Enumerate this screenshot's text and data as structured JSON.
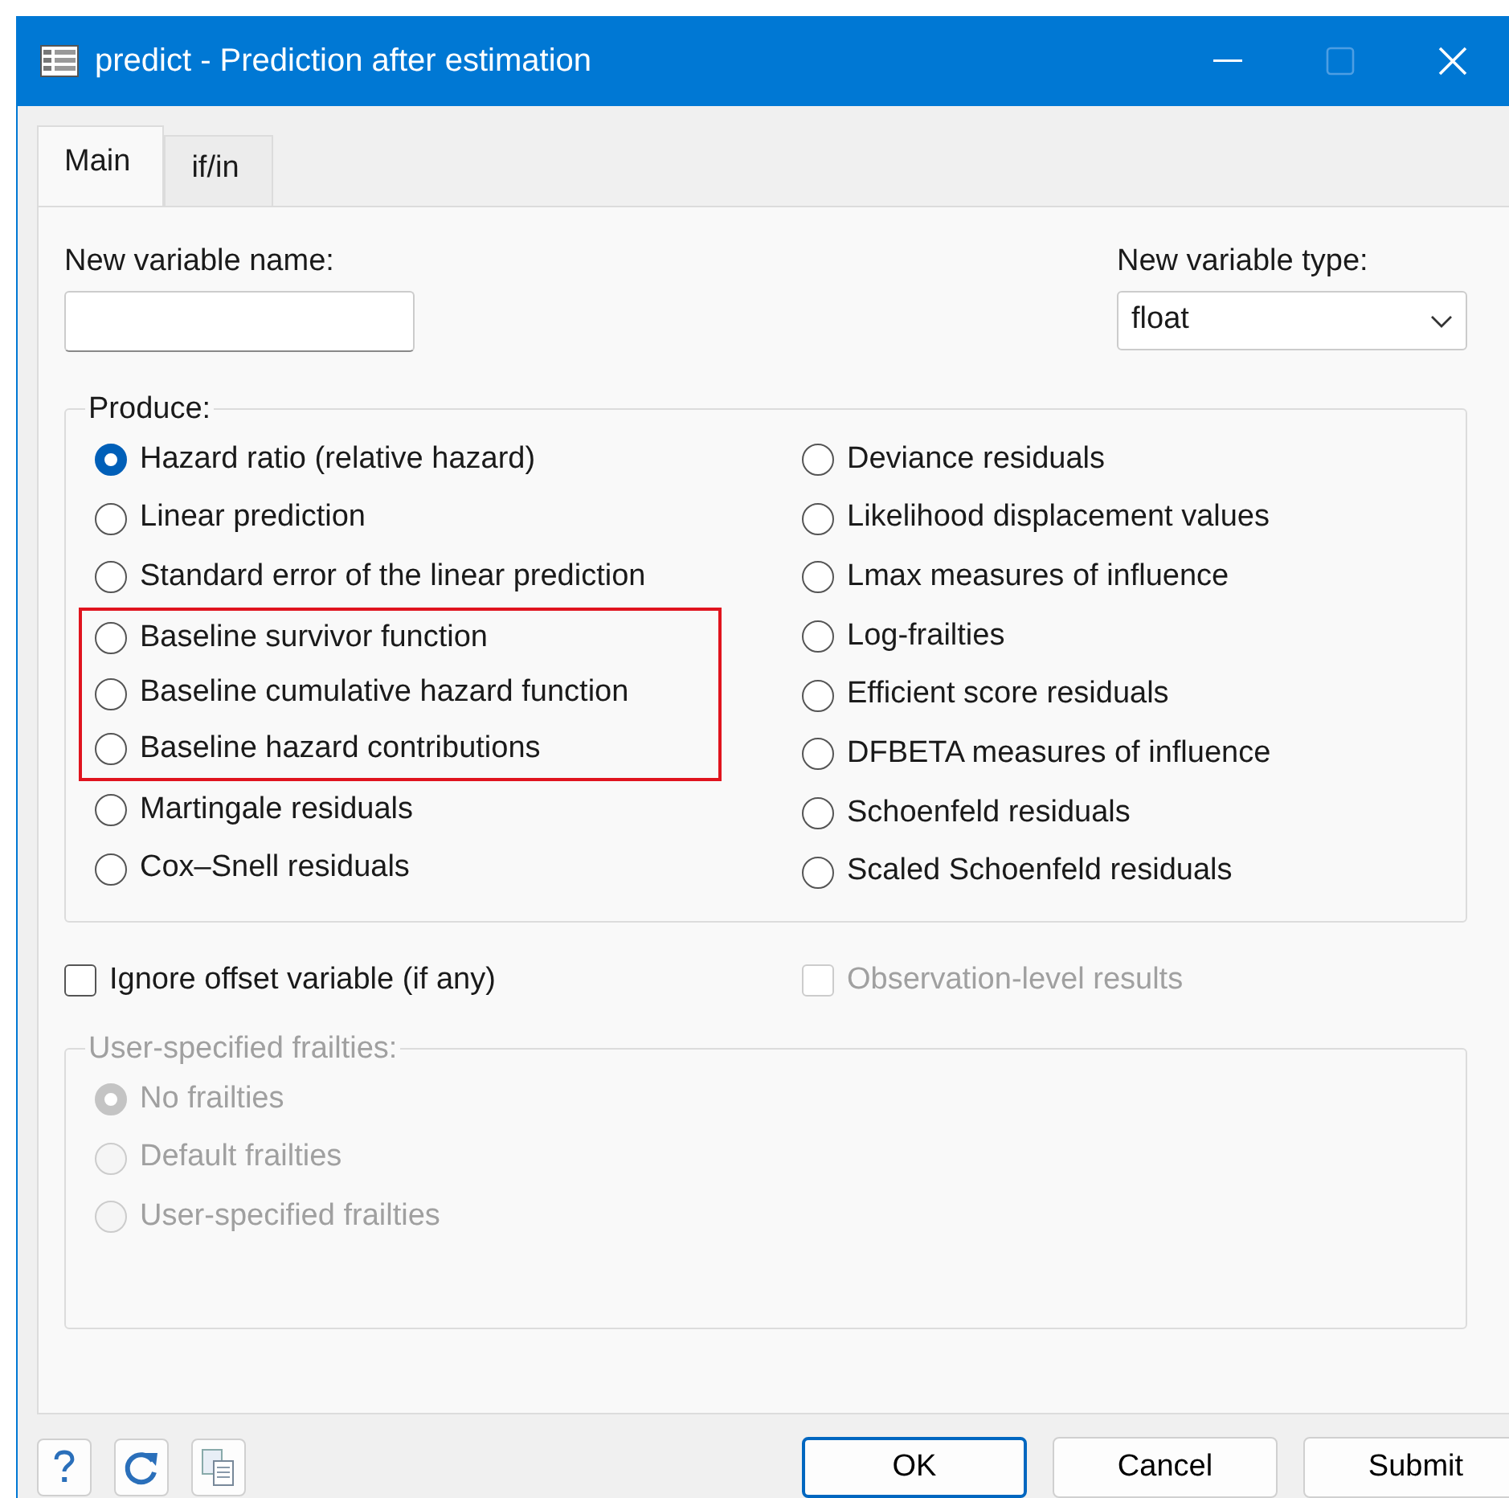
{
  "window": {
    "title": "predict - Prediction after estimation",
    "maximize_enabled": false
  },
  "tabs": [
    {
      "label": "Main",
      "selected": true
    },
    {
      "label": "if/in",
      "selected": false
    }
  ],
  "new_variable_name": {
    "label": "New variable name:"
  },
  "new_variable_type": {
    "label": "New variable type:",
    "value": "float"
  },
  "produce": {
    "legend": "Produce:",
    "columns": [
      [
        {
          "label": "Hazard ratio (relative hazard)",
          "selected": true,
          "highlighted": false
        },
        {
          "label": "Linear prediction",
          "selected": false,
          "highlighted": false
        },
        {
          "label": "Standard error of the linear prediction",
          "selected": false,
          "highlighted": false
        },
        {
          "label": "Baseline survivor function",
          "selected": false,
          "highlighted": true
        },
        {
          "label": "Baseline cumulative hazard function",
          "selected": false,
          "highlighted": true
        },
        {
          "label": "Baseline hazard contributions",
          "selected": false,
          "highlighted": true
        },
        {
          "label": "Martingale residuals",
          "selected": false,
          "highlighted": false
        },
        {
          "label": "Cox–Snell residuals",
          "selected": false,
          "highlighted": false
        }
      ],
      [
        {
          "label": "Deviance residuals",
          "selected": false,
          "highlighted": false
        },
        {
          "label": "Likelihood displacement values",
          "selected": false,
          "highlighted": false
        },
        {
          "label": "Lmax measures of influence",
          "selected": false,
          "highlighted": false
        },
        {
          "label": "Log-frailties",
          "selected": false,
          "highlighted": false
        },
        {
          "label": "Efficient score residuals",
          "selected": false,
          "highlighted": false
        },
        {
          "label": "DFBETA measures of influence",
          "selected": false,
          "highlighted": false
        },
        {
          "label": "Schoenfeld residuals",
          "selected": false,
          "highlighted": false
        },
        {
          "label": "Scaled Schoenfeld residuals",
          "selected": false,
          "highlighted": false
        }
      ]
    ]
  },
  "checkboxes": [
    {
      "label": "Ignore offset variable (if any)",
      "checked": false,
      "disabled": false
    },
    {
      "label": "Observation-level results",
      "checked": false,
      "disabled": true
    }
  ],
  "frailties": {
    "legend": "User-specified frailties:",
    "disabled": true,
    "options": [
      {
        "label": "No frailties",
        "selected": true
      },
      {
        "label": "Default frailties",
        "selected": false
      },
      {
        "label": "User-specified frailties",
        "selected": false
      }
    ]
  },
  "buttons": [
    {
      "label": "OK",
      "default": true
    },
    {
      "label": "Cancel",
      "default": false
    },
    {
      "label": "Submit",
      "default": false
    }
  ]
}
